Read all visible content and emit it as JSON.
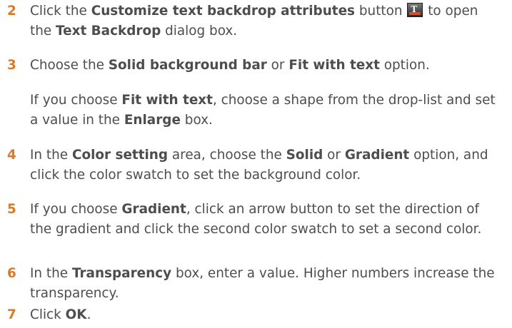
{
  "steps": [
    {
      "number": "2",
      "t1": "Click the ",
      "b1": "Customize text backdrop attributes",
      "t2": " button ",
      "t3": " to open the ",
      "b2": "Text Backdrop",
      "t4": " dialog box."
    },
    {
      "number": "3",
      "t1": "Choose the ",
      "b1": "Solid background bar",
      "t2": " or ",
      "b2": "Fit with text",
      "t3": " option."
    },
    {
      "number": "4",
      "t1": "In the ",
      "b1": "Color setting",
      "t2": " area, choose the ",
      "b2": "Solid",
      "t3": " or ",
      "b3": "Gradient",
      "t4": " option, and click the color swatch to set the background color."
    },
    {
      "number": "5",
      "t1": "If you choose ",
      "b1": "Gradient",
      "t2": ", click an arrow button to set the direction of the gradient and click the second color swatch to set a second color."
    },
    {
      "number": "6",
      "t1": "In the ",
      "b1": "Transparency",
      "t2": " box, enter a value. Higher numbers increase the transparency."
    },
    {
      "number": "7",
      "t1": "Click ",
      "b1": "OK",
      "t2": "."
    }
  ],
  "note": {
    "t1": "If you choose ",
    "b1": "Fit with text",
    "t2": ", choose a shape from the drop-list and set a value in the ",
    "b2": "Enlarge",
    "t3": " box."
  },
  "icons": {
    "customize_backdrop_button": "text-backdrop-icon"
  },
  "colors": {
    "step_number": "#d77a2a",
    "body_text": "#4d4d4d"
  }
}
